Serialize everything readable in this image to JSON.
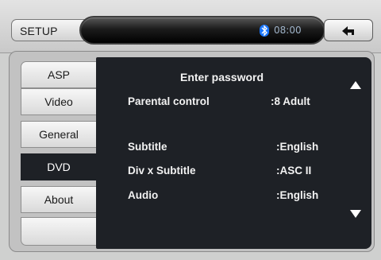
{
  "header": {
    "setup_label": "SETUP",
    "clock": "08:00",
    "bluetooth_icon": "bluetooth-icon",
    "back_icon": "back-arrow-icon"
  },
  "tabs": [
    {
      "label": "ASP",
      "active": false
    },
    {
      "label": "Video",
      "active": false
    },
    {
      "label": "General",
      "active": false
    },
    {
      "label": "DVD",
      "active": true
    },
    {
      "label": "About",
      "active": false
    },
    {
      "label": "",
      "active": false
    }
  ],
  "panel": {
    "title": "Enter  password",
    "settings": [
      {
        "label": "Parental control",
        "value": ":8 Adult"
      },
      {
        "label": "Subtitle",
        "value": ":English"
      },
      {
        "label": "Div x Subtitle",
        "value": ":ASC II"
      },
      {
        "label": "Audio",
        "value": ":English"
      }
    ],
    "scroll_up_icon": "scroll-up-icon",
    "scroll_down_icon": "scroll-down-icon"
  },
  "colors": {
    "panel_bg": "#1e2126",
    "active_tab_bg": "#1e2126",
    "bluetooth_blue": "#1976ff"
  }
}
